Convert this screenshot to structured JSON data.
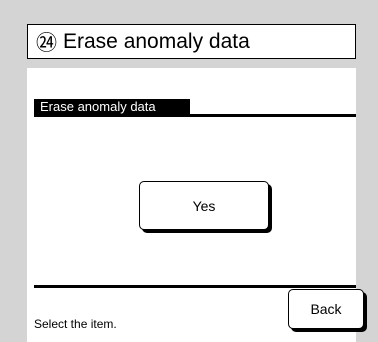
{
  "header": {
    "step_number": "㉔",
    "title": "Erase anomaly data"
  },
  "section": {
    "label": "Erase anomaly data"
  },
  "buttons": {
    "yes_label": "Yes",
    "back_label": "Back"
  },
  "status": {
    "message": "Select the item."
  },
  "colors": {
    "background": "#d4d4d4",
    "screen": "#ffffff",
    "foreground": "#000000"
  }
}
